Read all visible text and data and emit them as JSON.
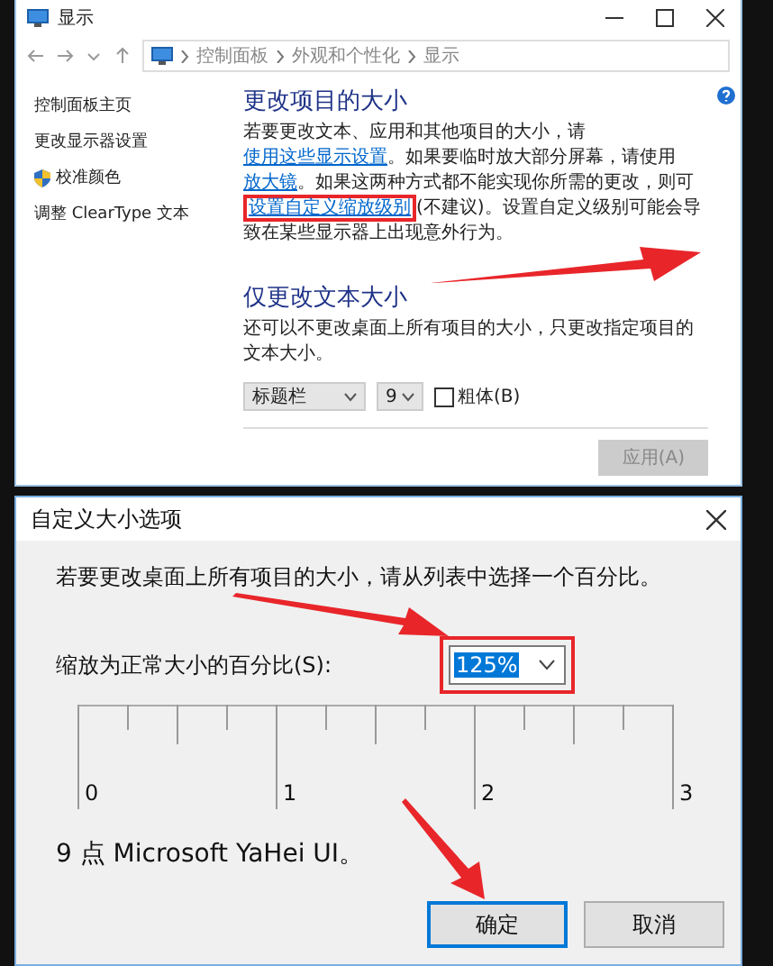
{
  "explorer": {
    "title": "显示",
    "breadcrumb": [
      "控制面板",
      "外观和个性化",
      "显示"
    ],
    "sidebar": {
      "items": [
        {
          "label": "控制面板主页",
          "kind": "plain"
        },
        {
          "label": "更改显示器设置",
          "kind": "plain"
        },
        {
          "label": "校准颜色",
          "kind": "shield"
        },
        {
          "label": "调整 ClearType 文本",
          "kind": "plain"
        }
      ]
    },
    "size_section": {
      "heading": "更改项目的大小",
      "paragraph": [
        {
          "kind": "text",
          "text": "若要更改文本、应用和其他项目的大小，请"
        },
        {
          "kind": "link",
          "text": "使用这些显示设置",
          "highlighted": false
        },
        {
          "kind": "text",
          "text": "。如果要临时放大部分屏幕，请使用"
        },
        {
          "kind": "link",
          "text": "放大镜",
          "highlighted": false
        },
        {
          "kind": "text",
          "text": "。如果这两种方式都不能实现你所需的更改，则可"
        },
        {
          "kind": "link",
          "text": "设置自定义缩放级别",
          "highlighted": true
        },
        {
          "kind": "text",
          "text": "(不建议)。设置自定义级别可能会导致在某些显示器上出现意外行为。"
        }
      ]
    },
    "text_section": {
      "heading": "仅更改文本大小",
      "description": "还可以不更改桌面上所有项目的大小，只更改指定项目的文本大小。",
      "item_select": {
        "value": "标题栏"
      },
      "size_select": {
        "value": "9"
      },
      "bold_checkbox": {
        "label": "粗体(B)",
        "checked": false
      }
    },
    "apply_button": {
      "label": "应用(A)",
      "disabled": true
    }
  },
  "dialog": {
    "title": "自定义大小选项",
    "prompt": "若要更改桌面上所有项目的大小，请从列表中选择一个百分比。",
    "scale_label": "缩放为正常大小的百分比(S):",
    "scale_select": {
      "value": "125%",
      "highlighted": true
    },
    "ruler_labels": [
      "0",
      "1",
      "2",
      "3"
    ],
    "sample_text": "9 点 Microsoft YaHei UI。",
    "buttons": [
      {
        "label": "确定",
        "default": true
      },
      {
        "label": "取消",
        "default": false
      }
    ]
  }
}
